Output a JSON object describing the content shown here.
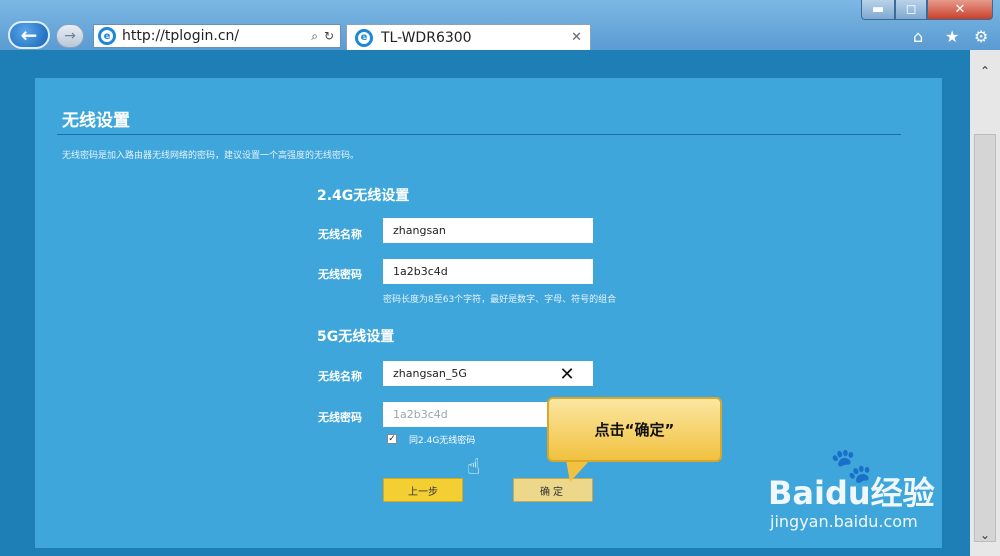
{
  "browser": {
    "url": "http://tplogin.cn/",
    "tab_title": "TL-WDR6300",
    "min_glyph": "▬",
    "max_glyph": "◻",
    "close_glyph": "✕",
    "back_glyph": "←",
    "fwd_glyph": "→",
    "addr_search_glyph": "⌕",
    "addr_refresh_glyph": "↻",
    "tab_close_glyph": "✕"
  },
  "panel": {
    "title": "无线设置",
    "description": "无线密码是加入路由器无线网络的密码，建议设置一个高强度的无线密码。"
  },
  "band_24": {
    "section_title": "2.4G无线设置",
    "name_label": "无线名称",
    "name_value": "zhangsan",
    "password_label": "无线密码",
    "password_value": "1a2b3c4d",
    "password_hint": "密码长度为8至63个字符，最好是数字、字母、符号的组合"
  },
  "band_5": {
    "section_title": "5G无线设置",
    "name_label": "无线名称",
    "name_value": "zhangsan_5G",
    "password_label": "无线密码",
    "password_value": "1a2b3c4d",
    "clear_glyph": "✕",
    "same_as_24_label": "同2.4G无线密码",
    "same_as_24_checked": true,
    "check_glyph": "✓"
  },
  "buttons": {
    "prev": "上一步",
    "confirm": "确定"
  },
  "callout": {
    "text": "点击“确定”"
  },
  "scrollbar": {
    "up_glyph": "⌃",
    "down_glyph": "⌄"
  },
  "watermark": {
    "main": "Baidu经验",
    "sub": "jingyan.baidu.com"
  },
  "colors": {
    "panel_bg": "#3fa6dc",
    "page_bg": "#1e7fb6",
    "button_yellow": "#f4cf33",
    "progress_active": "#8bd24a"
  },
  "icons": {
    "browser_tools": [
      "home-icon",
      "star-icon",
      "gear-icon"
    ]
  }
}
